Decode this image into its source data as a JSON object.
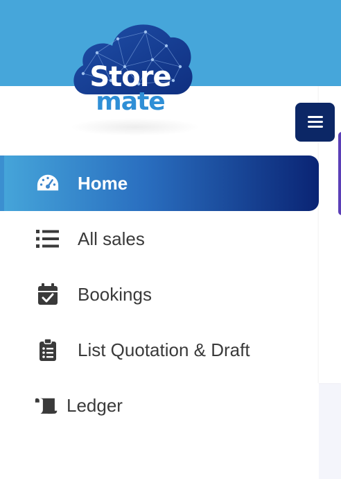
{
  "brand": {
    "line1": "Store",
    "line2": "mate",
    "colors": {
      "topbar": "#46a6da",
      "navy": "#0c2766",
      "accent": "#2f8fd6"
    }
  },
  "header": {
    "menu_icon": "hamburger-icon"
  },
  "sidebar": {
    "items": [
      {
        "label": "Home",
        "icon": "dashboard-gauge-icon",
        "active": true
      },
      {
        "label": "All sales",
        "icon": "list-icon",
        "active": false
      },
      {
        "label": "Bookings",
        "icon": "calendar-check-icon",
        "active": false
      },
      {
        "label": "List Quotation & Draft",
        "icon": "clipboard-list-icon",
        "active": false
      },
      {
        "label": "Ledger",
        "icon": "scroll-icon",
        "active": false
      }
    ]
  }
}
